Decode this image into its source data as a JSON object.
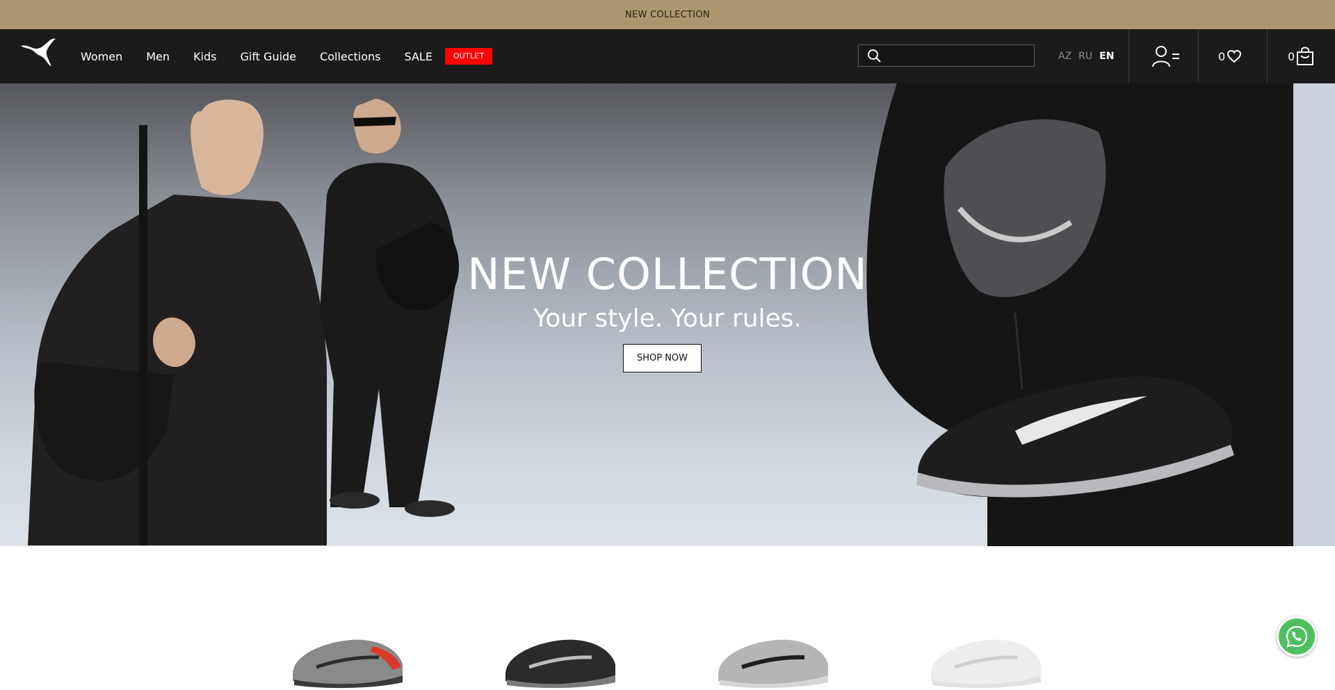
{
  "announcement": {
    "text": "NEW COLLECTION"
  },
  "header": {
    "logo": "puma-cat-logo",
    "nav": {
      "women": "Women",
      "men": "Men",
      "kids": "Kids",
      "gift_guide": "Gift Guide",
      "collections": "Collections",
      "sale": "SALE",
      "outlet": "OUTLET"
    },
    "search": {
      "placeholder": "",
      "value": "",
      "icon": "search-icon"
    },
    "languages": {
      "az": "AZ",
      "ru": "RU",
      "en": "EN",
      "active": "EN"
    },
    "account": {
      "icon": "user-menu-icon"
    },
    "wishlist": {
      "count": "0",
      "icon": "heart-icon"
    },
    "cart": {
      "count": "0",
      "icon": "shopping-bag-icon"
    }
  },
  "hero": {
    "title": "NEW COLLECTION",
    "subtitle": "Your style. Your rules.",
    "cta": "SHOP NOW"
  },
  "products": [
    {
      "name": "grey-red-sneaker"
    },
    {
      "name": "black-sneaker"
    },
    {
      "name": "silver-black-sneaker"
    },
    {
      "name": "white-sneaker"
    }
  ],
  "whatsapp": {
    "icon": "whatsapp-icon"
  },
  "colors": {
    "announcement_bg": "#ab966f",
    "header_bg": "#1b1b1b",
    "outlet_red": "#ff0000",
    "whatsapp_green": "#4ec15e"
  }
}
